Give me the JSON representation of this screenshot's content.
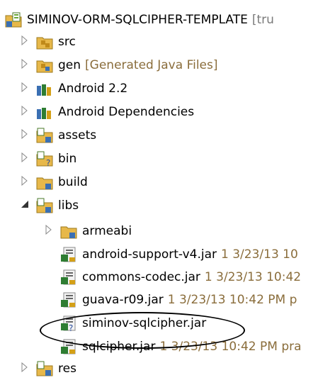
{
  "tree": {
    "project": {
      "name": "SIMINOV-ORM-SQLCIPHER-TEMPLATE",
      "decoration": "[tru"
    },
    "items": [
      {
        "name": "src",
        "decoration": ""
      },
      {
        "name": "gen",
        "decoration": "[Generated Java Files]"
      },
      {
        "name": "Android 2.2",
        "decoration": ""
      },
      {
        "name": "Android Dependencies",
        "decoration": ""
      },
      {
        "name": "assets",
        "decoration": ""
      },
      {
        "name": "bin",
        "decoration": ""
      },
      {
        "name": "build",
        "decoration": ""
      },
      {
        "name": "libs",
        "decoration": ""
      },
      {
        "name": "armeabi",
        "decoration": ""
      },
      {
        "name": "android-support-v4.jar",
        "decoration": "1  3/23/13 10"
      },
      {
        "name": "commons-codec.jar",
        "decoration": "1  3/23/13 10:42"
      },
      {
        "name": "guava-r09.jar",
        "decoration": "1  3/23/13 10:42 PM  p"
      },
      {
        "name": "siminov-sqlcipher.jar",
        "decoration": ""
      },
      {
        "name": "sqlcipher.jar",
        "decoration": "1  3/23/13 10:42 PM  pra"
      },
      {
        "name": "res",
        "decoration": ""
      }
    ]
  }
}
